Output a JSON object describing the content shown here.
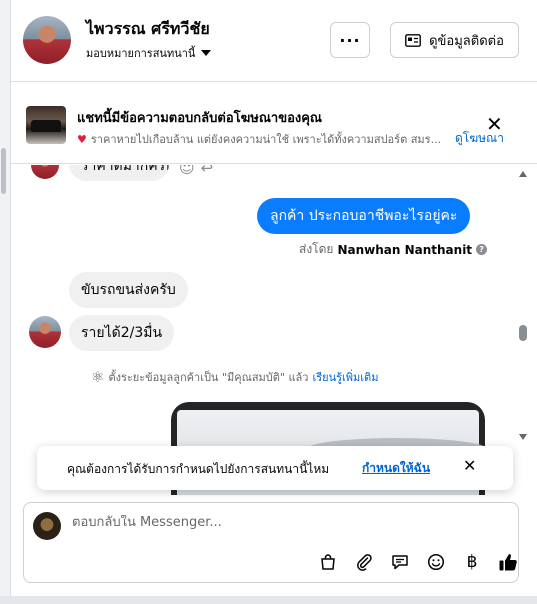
{
  "header": {
    "name": "ไพวรรณ ศรีทวีชัย",
    "assign_label": "มอบหมายการสนทนานี้",
    "more_label": "···",
    "contact_button": "ดูข้อมูลติดต่อ"
  },
  "ad_banner": {
    "title": "แชทนี้มีข้อความตอบกลับต่อโฆษณาของคุณ",
    "text": "ราคาหายไปเกือบล้าน แต่ยังคงความน่าใช้ เพราะได้ทั้งความสปอร์ต สมร...",
    "link": "ดูโฆษณา"
  },
  "messages": {
    "previous_partial": "ราคาดีมากครับ",
    "sent_text": "ลูกค้า ประกอบอาชีพอะไรอยู่คะ",
    "sent_by_prefix": "ส่งโดย",
    "sent_by_name": "Nanwhan Nanthanit",
    "received": [
      "ขับรถขนส่งครับ",
      "รายได้2/3มื่น"
    ]
  },
  "system_note": {
    "text": "ตั้งระยะข้อมูลลูกค้าเป็น \"มีคุณสมบัติ\" แล้ว",
    "link": "เรียนรู้เพิ่มเติม"
  },
  "toast": {
    "text": "คุณต้องการได้รับการกำหนดไปยังการสนทนานี้ไหม",
    "link": "กำหนดให้ฉัน"
  },
  "composer": {
    "placeholder": "ตอบกลับใน Messenger..."
  },
  "colors": {
    "accent": "#0a7cff",
    "link": "#0064d1",
    "bubble_received": "#f0f0f0"
  }
}
